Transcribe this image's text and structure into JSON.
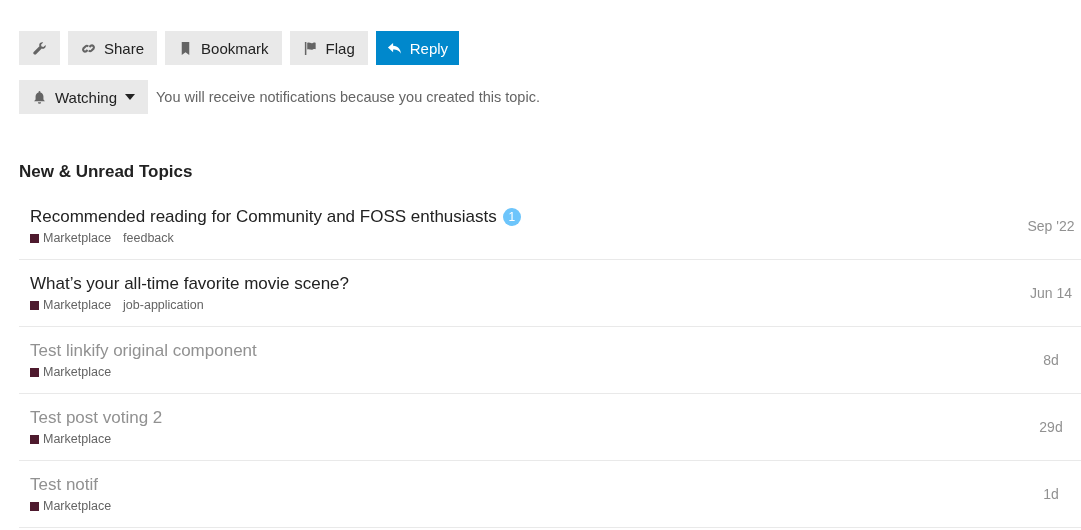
{
  "actions": [
    {
      "kind": "default"
    },
    {
      "label": "Share",
      "kind": "default"
    },
    {
      "label": "Bookmark",
      "kind": "default"
    },
    {
      "label": "Flag",
      "kind": "default"
    },
    {
      "label": "Reply",
      "kind": "primary"
    }
  ],
  "notifications": {
    "level_label": "Watching",
    "description": "You will receive notifications because you created this topic."
  },
  "section_title": "New & Unread Topics",
  "topics": [
    {
      "title": "Recommended reading for Community and FOSS enthusiasts",
      "read": false,
      "unread_count": "1",
      "category": "Marketplace",
      "tag": "feedback",
      "activity": "Sep '22"
    },
    {
      "title": "What’s your all-time favorite movie scene?",
      "read": false,
      "category": "Marketplace",
      "tag": "job-application",
      "activity": "Jun 14"
    },
    {
      "title": "Test linkify original component",
      "read": true,
      "category": "Marketplace",
      "activity": "8d"
    },
    {
      "title": "Test post voting 2",
      "read": true,
      "category": "Marketplace",
      "activity": "29d"
    },
    {
      "title": "Test notif",
      "read": true,
      "category": "Marketplace",
      "activity": "1d"
    }
  ]
}
